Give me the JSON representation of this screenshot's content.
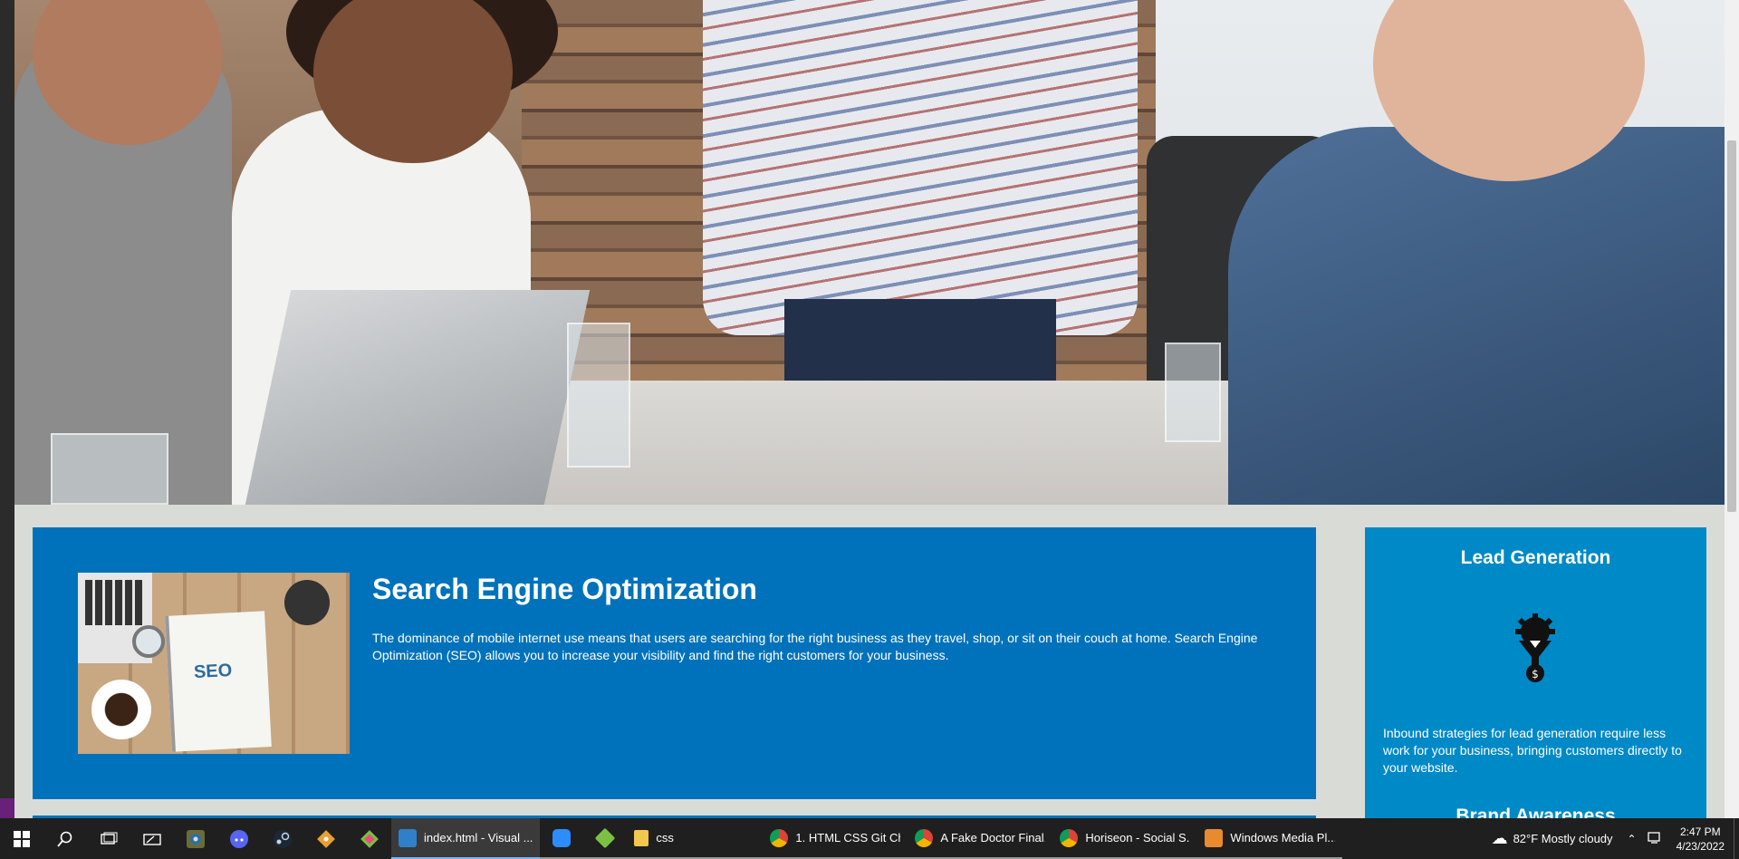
{
  "seo": {
    "title": "Search Engine Optimization",
    "text": "The dominance of mobile internet use means that users are searching for the right business as they travel, shop, or sit on their couch at home. Search Engine Optimization (SEO) allows you to increase your visibility and find the right customers for your business.",
    "image_word": "SEO"
  },
  "sidebar": {
    "lead_title": "Lead Generation",
    "lead_text": "Inbound strategies for lead generation require less work for your business, bringing customers directly to your website.",
    "brand_title": "Brand Awareness"
  },
  "colors": {
    "page_bg": "#d9dcd6",
    "card_blue": "#0072bb",
    "sidebar_blue": "#0089c7",
    "taskbar": "#1f1f1f"
  },
  "taskbar": {
    "icons": [
      "windows-start-icon",
      "search-icon",
      "task-view-icon",
      "snipping-icon",
      "app-gear-icon",
      "discord-icon",
      "steam-icon",
      "git-icon",
      "gitkraken-icon"
    ],
    "apps": [
      {
        "label": "index.html - Visual ...",
        "icon": "vscode-icon"
      },
      {
        "label": "",
        "icon": "zoom-icon"
      },
      {
        "label": "",
        "icon": "gitkraken-icon"
      },
      {
        "label": "css",
        "icon": "folder-icon"
      },
      {
        "label": "1. HTML CSS Git Ch...",
        "icon": "chrome-icon"
      },
      {
        "label": "A Fake Doctor Final...",
        "icon": "chrome-icon"
      },
      {
        "label": "Horiseon - Social S...",
        "icon": "chrome-icon"
      },
      {
        "label": "Windows Media Pl...",
        "icon": "media-player-icon"
      }
    ],
    "weather": "82°F  Mostly cloudy",
    "time": "2:47 PM",
    "date": "4/23/2022"
  }
}
